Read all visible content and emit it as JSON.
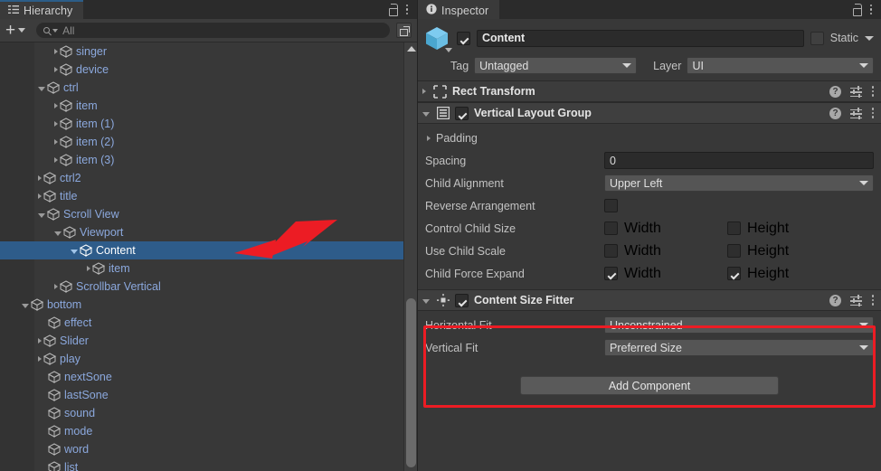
{
  "hierarchy": {
    "tab_label": "Hierarchy",
    "tab_icon": "hierarchy-icon",
    "lock_icon": "lock-icon",
    "menu_icon": "kebab-menu-icon",
    "toolbar": {
      "add_label": "+",
      "search_placeholder": "All",
      "search_value": "",
      "search_icon": "search-icon",
      "popout_icon": "popout-icon"
    },
    "rows": [
      {
        "label": "singer",
        "depth": 3,
        "twist": "closed",
        "selected": false
      },
      {
        "label": "device",
        "depth": 3,
        "twist": "closed",
        "selected": false
      },
      {
        "label": "ctrl",
        "depth": 2,
        "twist": "open",
        "selected": false
      },
      {
        "label": "item",
        "depth": 3,
        "twist": "closed",
        "selected": false
      },
      {
        "label": "item (1)",
        "depth": 3,
        "twist": "closed",
        "selected": false
      },
      {
        "label": "item (2)",
        "depth": 3,
        "twist": "closed",
        "selected": false
      },
      {
        "label": "item (3)",
        "depth": 3,
        "twist": "closed",
        "selected": false
      },
      {
        "label": "ctrl2",
        "depth": 2,
        "twist": "closed",
        "selected": false
      },
      {
        "label": "title",
        "depth": 2,
        "twist": "closed",
        "selected": false
      },
      {
        "label": "Scroll View",
        "depth": 2,
        "twist": "open",
        "selected": false
      },
      {
        "label": "Viewport",
        "depth": 3,
        "twist": "open",
        "selected": false
      },
      {
        "label": "Content",
        "depth": 4,
        "twist": "open",
        "selected": true
      },
      {
        "label": "item",
        "depth": 5,
        "twist": "closed",
        "selected": false
      },
      {
        "label": "Scrollbar Vertical",
        "depth": 3,
        "twist": "closed",
        "selected": false
      },
      {
        "label": "bottom",
        "depth": 1,
        "twist": "open",
        "selected": false
      },
      {
        "label": "effect",
        "depth": 2,
        "twist": "none",
        "selected": false
      },
      {
        "label": "Slider",
        "depth": 2,
        "twist": "closed",
        "selected": false
      },
      {
        "label": "play",
        "depth": 2,
        "twist": "closed",
        "selected": false
      },
      {
        "label": "nextSone",
        "depth": 2,
        "twist": "none",
        "selected": false
      },
      {
        "label": "lastSone",
        "depth": 2,
        "twist": "none",
        "selected": false
      },
      {
        "label": "sound",
        "depth": 2,
        "twist": "none",
        "selected": false
      },
      {
        "label": "mode",
        "depth": 2,
        "twist": "none",
        "selected": false
      },
      {
        "label": "word",
        "depth": 2,
        "twist": "none",
        "selected": false
      },
      {
        "label": "list",
        "depth": 2,
        "twist": "none",
        "selected": false
      }
    ]
  },
  "inspector": {
    "tab_label": "Inspector",
    "tab_icon": "info-icon",
    "lock_icon": "lock-icon",
    "menu_icon": "kebab-menu-icon",
    "gameobject": {
      "icon": "gameobject-cube-icon",
      "enabled": true,
      "name": "Content",
      "static_label": "Static",
      "static_checked": false,
      "tag_label": "Tag",
      "tag_value": "Untagged",
      "layer_label": "Layer",
      "layer_value": "UI"
    },
    "components": [
      {
        "title": "Rect Transform",
        "icon": "rect-transform-icon",
        "expanded": false,
        "has_enable_toggle": false,
        "help_icon": "help-icon",
        "preset_icon": "preset-icon",
        "menu_icon": "kebab-menu-icon"
      },
      {
        "title": "Vertical Layout Group",
        "icon": "vertical-layout-group-icon",
        "expanded": true,
        "has_enable_toggle": true,
        "enabled": true,
        "help_icon": "help-icon",
        "preset_icon": "preset-icon",
        "menu_icon": "kebab-menu-icon",
        "fields": [
          {
            "kind": "foldout",
            "label": "Padding"
          },
          {
            "kind": "text",
            "label": "Spacing",
            "value": "0"
          },
          {
            "kind": "dropdown",
            "label": "Child Alignment",
            "value": "Upper Left"
          },
          {
            "kind": "check1",
            "label": "Reverse Arrangement",
            "checked": false
          },
          {
            "kind": "check2",
            "label": "Control Child Size",
            "a_label": "Width",
            "a_checked": false,
            "b_label": "Height",
            "b_checked": false
          },
          {
            "kind": "check2",
            "label": "Use Child Scale",
            "a_label": "Width",
            "a_checked": false,
            "b_label": "Height",
            "b_checked": false
          },
          {
            "kind": "check2",
            "label": "Child Force Expand",
            "a_label": "Width",
            "a_checked": true,
            "b_label": "Height",
            "b_checked": true
          }
        ]
      },
      {
        "title": "Content Size Fitter",
        "icon": "content-size-fitter-icon",
        "expanded": true,
        "has_enable_toggle": true,
        "enabled": true,
        "highlighted": true,
        "help_icon": "help-icon",
        "preset_icon": "preset-icon",
        "menu_icon": "kebab-menu-icon",
        "fields": [
          {
            "kind": "dropdown",
            "label": "Horizontal Fit",
            "value": "Unconstrained"
          },
          {
            "kind": "dropdown",
            "label": "Vertical Fit",
            "value": "Preferred Size"
          }
        ]
      }
    ],
    "add_component_label": "Add Component"
  },
  "annotations": {
    "highlight_color": "#ec1c24",
    "arrow_color": "#ec1c24",
    "arrow_target": "Content",
    "selection_color": "#2e5c8a"
  }
}
